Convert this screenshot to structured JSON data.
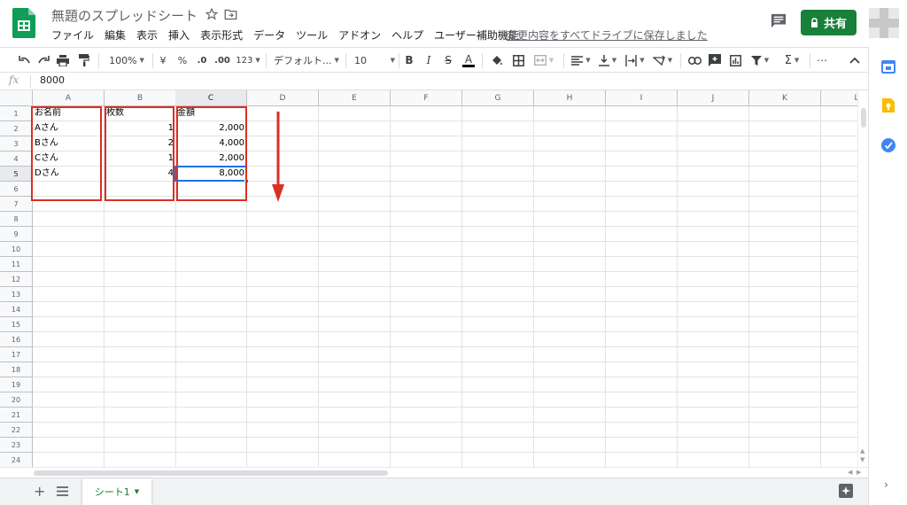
{
  "header": {
    "doc_title": "無題のスプレッドシート",
    "menu": [
      "ファイル",
      "編集",
      "表示",
      "挿入",
      "表示形式",
      "データ",
      "ツール",
      "アドオン",
      "ヘルプ",
      "ユーザー補助機能"
    ],
    "save_status": "変更内容をすべてドライブに保存しました",
    "share_label": "共有",
    "brand_color": "#188038"
  },
  "toolbar": {
    "zoom": "100%",
    "currency": "¥",
    "percent": "%",
    "decrease_decimal": ".0",
    "increase_decimal": ".00",
    "more_formats": "123",
    "font": "デフォルト...",
    "font_size": "10",
    "bold": "B",
    "italic": "I",
    "strike": "S",
    "text_color": "A",
    "text_color_value": "#000000",
    "sum": "Σ",
    "more": "⋯"
  },
  "formula_bar": {
    "fx_label": "fx",
    "value": "8000"
  },
  "grid": {
    "columns": [
      "A",
      "B",
      "C",
      "D",
      "E",
      "F",
      "G",
      "H",
      "I",
      "J",
      "K",
      "L"
    ],
    "rows": [
      "1",
      "2",
      "3",
      "4",
      "5",
      "6",
      "7",
      "8",
      "9",
      "10",
      "11",
      "12",
      "13",
      "14",
      "15",
      "16",
      "17",
      "18",
      "19",
      "20",
      "21",
      "22",
      "23",
      "24"
    ],
    "active_cell": "C5",
    "cells": [
      [
        "お名前",
        "枚数",
        "金額"
      ],
      [
        "Aさん",
        "1",
        "2,000"
      ],
      [
        "Bさん",
        "2",
        "4,000"
      ],
      [
        "Cさん",
        "1",
        "2,000"
      ],
      [
        "Dさん",
        "4",
        "8,000"
      ]
    ],
    "annotation_color": "#d93025"
  },
  "sheet_bar": {
    "tab_label": "シート1"
  }
}
